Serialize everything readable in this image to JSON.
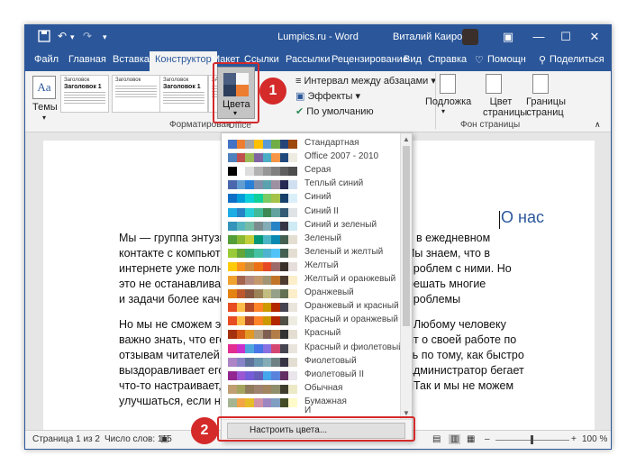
{
  "title": {
    "app_title": "Lumpics.ru - Word",
    "user_name": "Виталий Каиров",
    "buttons": {
      "minimize": "—",
      "restore": "☐",
      "close": "✕",
      "ribbon_options": "▣"
    }
  },
  "menu": {
    "tabs": [
      "Файл",
      "Главная",
      "Вставка",
      "Конструктор",
      "Макет",
      "Ссылки",
      "Рассылки",
      "Рецензирование",
      "Вид",
      "Справка"
    ],
    "help_search": "Помощн",
    "share": "Поделиться"
  },
  "ribbon": {
    "themes_label": "Темы",
    "theme_icon_text": "Aa",
    "style_thumbs": [
      {
        "t1": "Заголовок",
        "t2": "Заголовок 1"
      },
      {
        "t1": "Заголовок",
        "t2": ""
      },
      {
        "t1": "Заголовок",
        "t2": "Заголовок 1"
      },
      {
        "t1": "ЗАГОЛОВОК",
        "t2": ""
      }
    ],
    "colors_label": "Цвета",
    "paragraph_spacing": "Интервал между абзацами",
    "effects": "Эффекты",
    "default": "По умолчанию",
    "group_formatting": "Форматирован",
    "watermark": "Подложка",
    "page_color": "Цвет страницы",
    "page_borders": "Границы страниц",
    "group_page_bg": "Фон страницы"
  },
  "dropdown": {
    "header": "Office",
    "items": [
      {
        "label": "Стандартная",
        "colors": [
          "#4472c4",
          "#ed7d31",
          "#a5a5a5",
          "#ffc000",
          "#5b9bd5",
          "#70ad47",
          "#264478",
          "#9e480e"
        ]
      },
      {
        "label": "Office 2007 - 2010",
        "colors": [
          "#4f81bd",
          "#c0504d",
          "#9bbb59",
          "#8064a2",
          "#4bacc6",
          "#f79646",
          "#1f497d",
          "#eeece1"
        ]
      },
      {
        "label": "Серая",
        "colors": [
          "#000000",
          "#ffffff",
          "#dddddd",
          "#b2b2b2",
          "#969696",
          "#808080",
          "#5f5f5f",
          "#4d4d4d"
        ]
      },
      {
        "label": "Теплый синий",
        "colors": [
          "#4a66ac",
          "#629dd1",
          "#297fd5",
          "#7f8fa9",
          "#5aa2ae",
          "#9d90a0",
          "#242852",
          "#d1e0f0"
        ]
      },
      {
        "label": "Синий",
        "colors": [
          "#0f6fc6",
          "#009dd9",
          "#0bd0d9",
          "#10cf9b",
          "#7cca62",
          "#a5c249",
          "#17406d",
          "#dbeff9"
        ]
      },
      {
        "label": "Синий II",
        "colors": [
          "#1cade4",
          "#2683c6",
          "#27ced7",
          "#42ba97",
          "#3e8853",
          "#62a39f",
          "#335b74",
          "#dfe3e5"
        ]
      },
      {
        "label": "Синий и зеленый",
        "colors": [
          "#3494ba",
          "#58b6c0",
          "#75bda7",
          "#7a8c8e",
          "#84acb6",
          "#2683c6",
          "#373545",
          "#ceeaf4"
        ]
      },
      {
        "label": "Зеленый",
        "colors": [
          "#549e39",
          "#8ab833",
          "#c0cf3a",
          "#029676",
          "#4ab5c4",
          "#0989b1",
          "#455f51",
          "#e3ded1"
        ]
      },
      {
        "label": "Зеленый и желтый",
        "colors": [
          "#99cb38",
          "#63a537",
          "#37a76f",
          "#44c1a3",
          "#4eb3cf",
          "#51c3f9",
          "#455f51",
          "#e3ded1"
        ]
      },
      {
        "label": "Желтый",
        "colors": [
          "#ffca08",
          "#f8931d",
          "#ce8d3e",
          "#ec7016",
          "#e64823",
          "#9c6a6a",
          "#39302a",
          "#e5dedb"
        ]
      },
      {
        "label": "Желтый и оранжевый",
        "colors": [
          "#f0a22e",
          "#a5644e",
          "#b58b80",
          "#c3986d",
          "#a19574",
          "#c17529",
          "#4e3b30",
          "#fbeec9"
        ]
      },
      {
        "label": "Оранжевый",
        "colors": [
          "#e48312",
          "#bd582c",
          "#865640",
          "#9b8357",
          "#c2bc80",
          "#94a088",
          "#637052",
          "#fbeec9"
        ]
      },
      {
        "label": "Оранжевый и красный",
        "colors": [
          "#e84c22",
          "#ffbd47",
          "#b64926",
          "#ff8427",
          "#cc9900",
          "#b22600",
          "#454551",
          "#e9e5dc"
        ]
      },
      {
        "label": "Красный и оранжевый",
        "colors": [
          "#e84c22",
          "#ffbd47",
          "#b64926",
          "#ff8427",
          "#cc9900",
          "#b22600",
          "#505046",
          "#eeece1"
        ]
      },
      {
        "label": "Красный",
        "colors": [
          "#a5300f",
          "#d55816",
          "#e19825",
          "#b19c7d",
          "#7f5f52",
          "#b27d49",
          "#323232",
          "#e3ded1"
        ]
      },
      {
        "label": "Красный и фиолетовый",
        "colors": [
          "#e32d91",
          "#c830cc",
          "#4ea6dc",
          "#4775e7",
          "#8971e1",
          "#d54773",
          "#454551",
          "#e9e5dc"
        ]
      },
      {
        "label": "Фиолетовый",
        "colors": [
          "#ad84c6",
          "#8784c7",
          "#5d739a",
          "#6997af",
          "#84acb6",
          "#6f8183",
          "#373545",
          "#e3ded1"
        ]
      },
      {
        "label": "Фиолетовый II",
        "colors": [
          "#92278f",
          "#9b57d3",
          "#755dd9",
          "#665eb8",
          "#45a5ed",
          "#5982db",
          "#632e62",
          "#eae5eb"
        ]
      },
      {
        "label": "Обычная",
        "colors": [
          "#bf9e71",
          "#a4a45f",
          "#8f7a5b",
          "#9f8170",
          "#a2845e",
          "#8e8e6d",
          "#3e3d2d",
          "#ece9c6"
        ]
      },
      {
        "label": "Бумажная",
        "colors": [
          "#a5b592",
          "#f3a447",
          "#e7bc29",
          "#d092a7",
          "#9c85c0",
          "#809ec2",
          "#444d26",
          "#fefac9"
        ]
      }
    ],
    "partial_item": "И",
    "customize_label": "Настроить цвета..."
  },
  "document": {
    "heading": "О нас",
    "paragraph1": [
      "Мы — группа энтузи",
      "ам в ежедневном",
      "контакте с компьют",
      ". Мы знаем, что в",
      "интернете уже полн",
      "проблем с ними. Но",
      "это не останавливае",
      "решать многие проблемы",
      "и задачи более каче"
    ],
    "paragraph2": [
      "Но мы не сможем эт",
      ". Любому человеку",
      "важно знать, что его",
      "ит о своей работе по",
      "отзывам читателей.",
      "ть по тому, как быстро",
      "выздоравливает его",
      "администратор бегает и",
      "что-то настраивает,",
      ". Так и мы не можем",
      "улучшаться, если не"
    ]
  },
  "status": {
    "page": "Страница 1 из 2",
    "words": "Число слов: 115",
    "zoom": "100 %"
  },
  "callouts": [
    "1",
    "2"
  ]
}
